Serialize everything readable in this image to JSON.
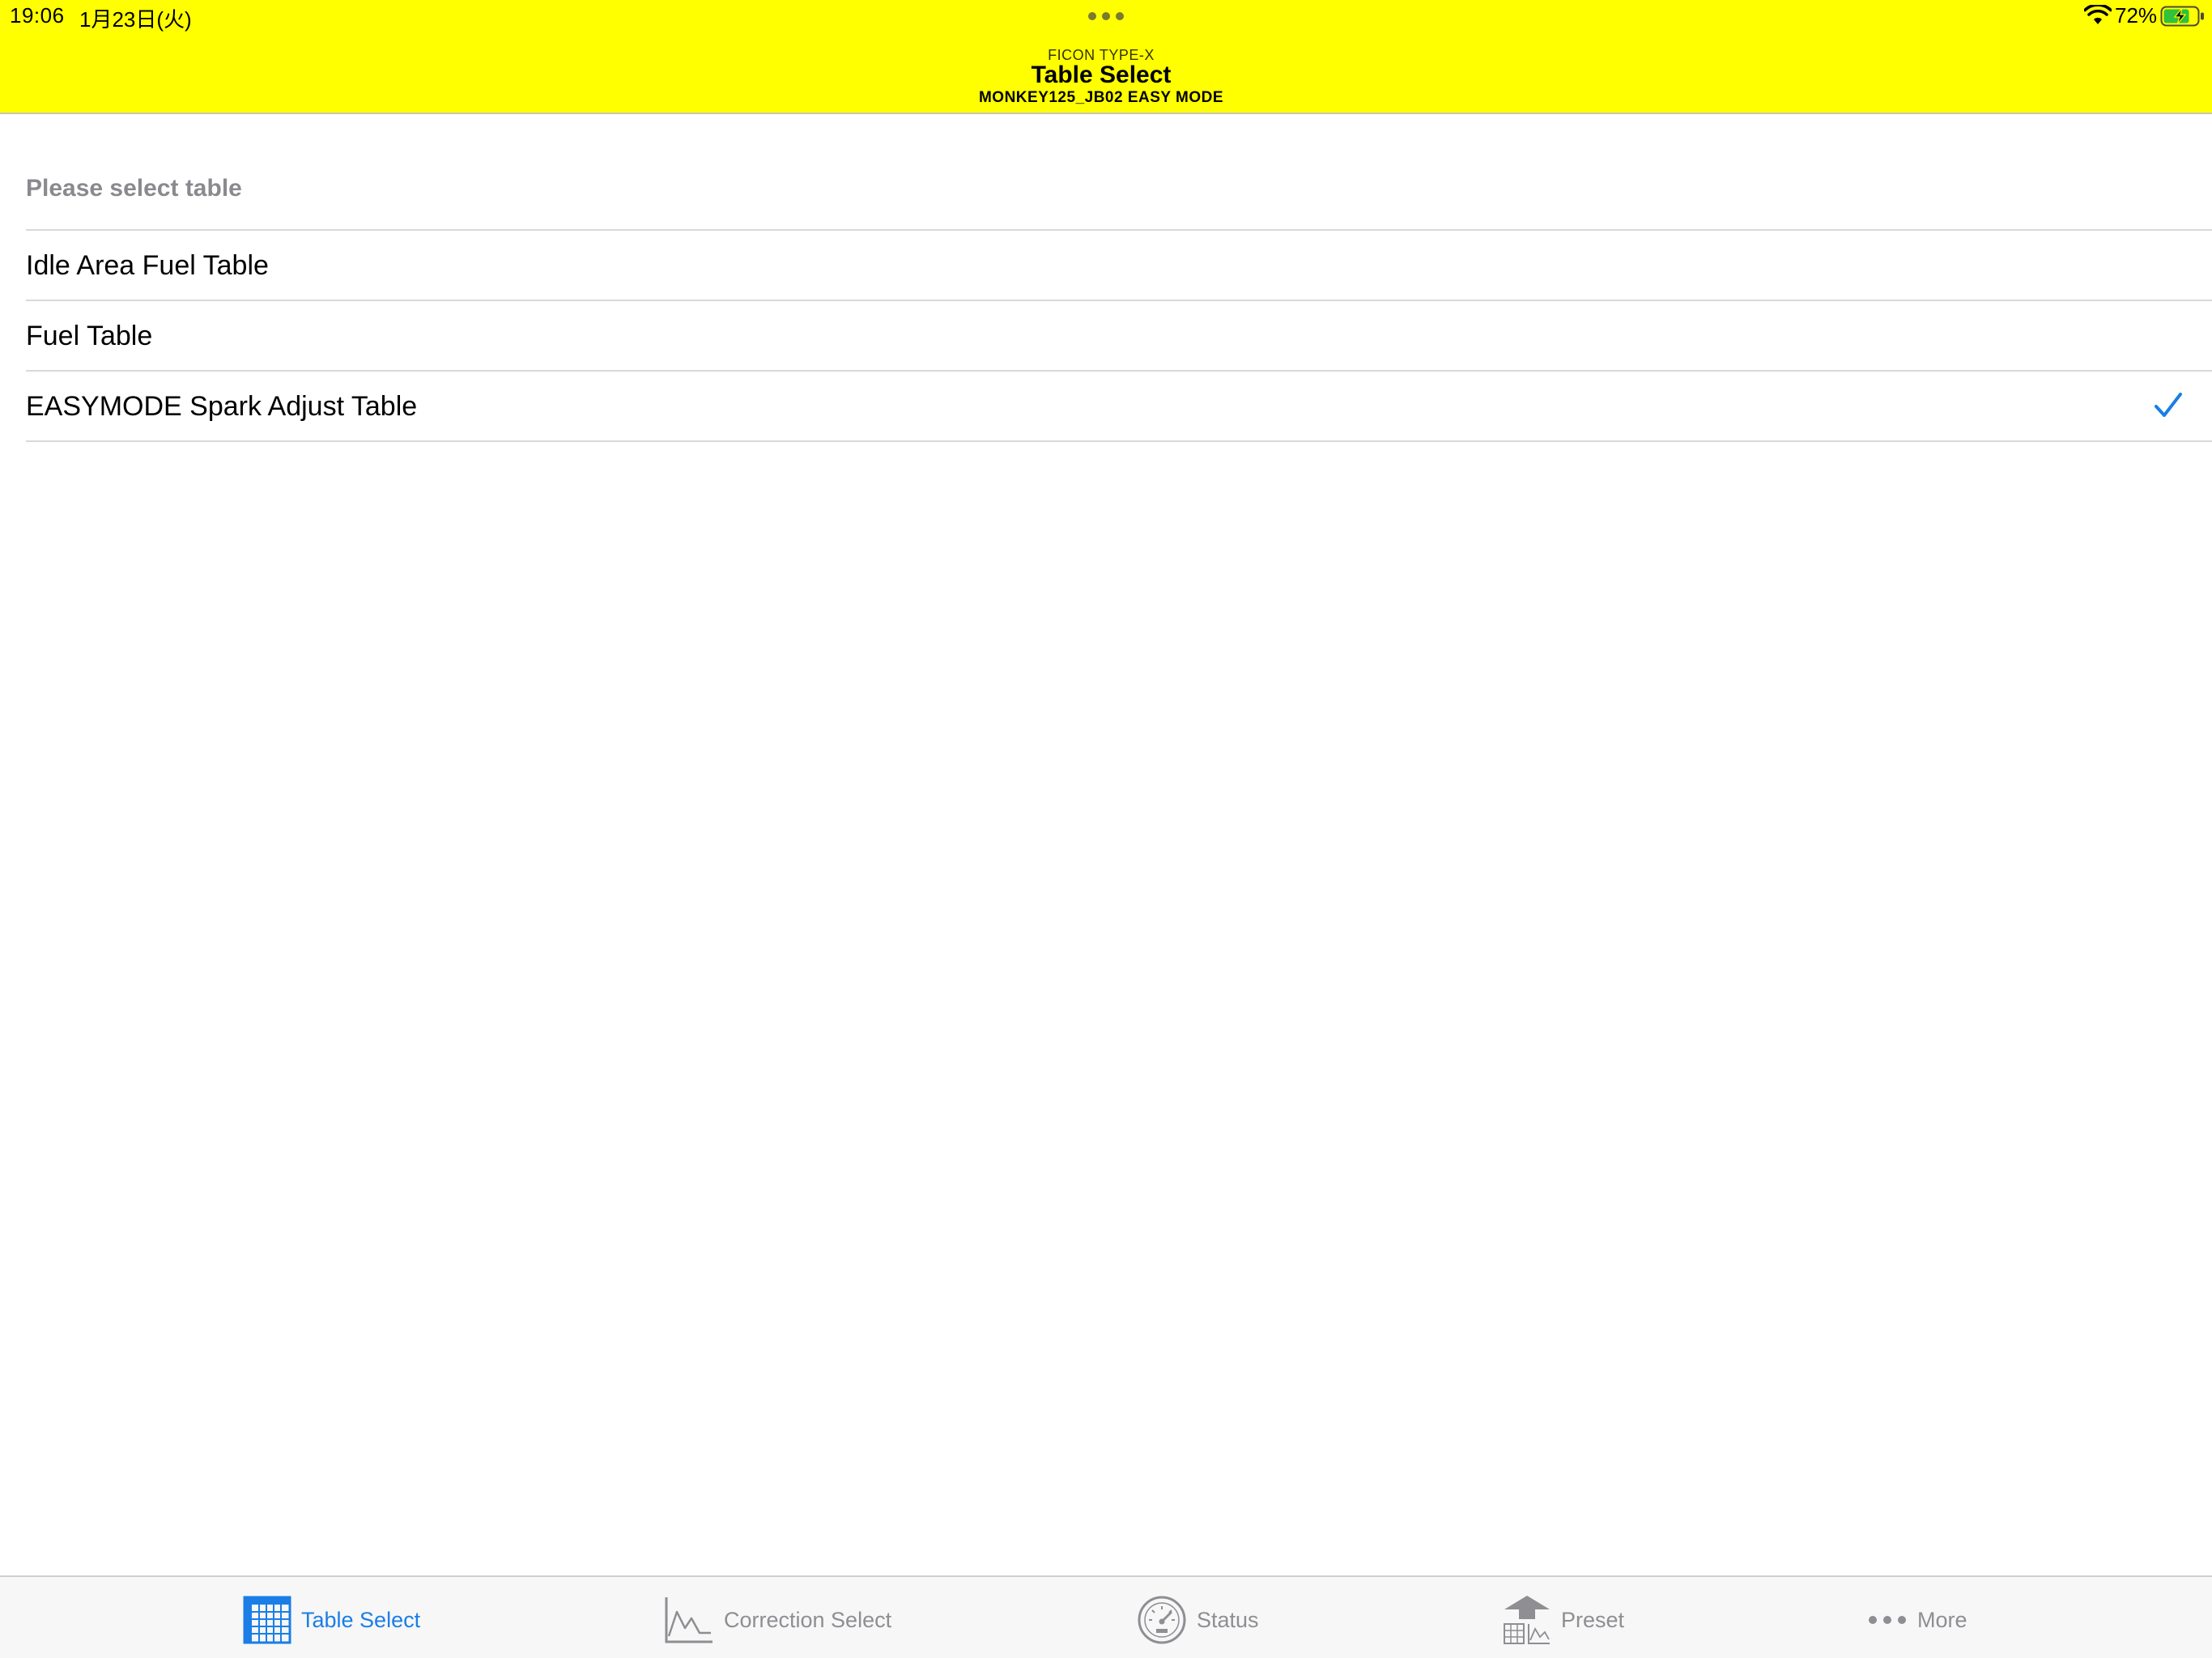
{
  "status_bar": {
    "time": "19:06",
    "date": "1月23日(火)",
    "battery_percent": "72%"
  },
  "nav": {
    "caption": "FICON TYPE-X",
    "title": "Table Select",
    "subtitle": "MONKEY125_JB02 EASY MODE"
  },
  "section": {
    "header": "Please select table"
  },
  "tables": [
    {
      "label": "Idle Area Fuel Table",
      "selected": false
    },
    {
      "label": "Fuel Table",
      "selected": false
    },
    {
      "label": "EASYMODE Spark Adjust Table",
      "selected": true
    }
  ],
  "tabbar": {
    "tabs": [
      {
        "label": "Table Select",
        "icon": "table-grid-icon",
        "active": true
      },
      {
        "label": "Correction Select",
        "icon": "line-graph-icon",
        "active": false
      },
      {
        "label": "Status",
        "icon": "gauge-icon",
        "active": false
      },
      {
        "label": "Preset",
        "icon": "preset-upload-icon",
        "active": false
      },
      {
        "label": "More",
        "icon": "more-dots-icon",
        "active": false
      }
    ]
  },
  "colors": {
    "header_background": "#ffff00",
    "accent": "#1a7ee6",
    "inactive_tab": "#8e8e93"
  }
}
